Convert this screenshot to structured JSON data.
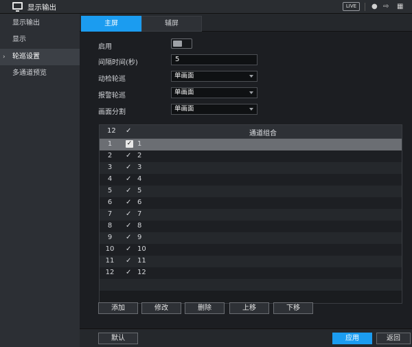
{
  "titlebar": {
    "title": "显示输出",
    "live_label": "LIVE",
    "icons": [
      "monitor-icon",
      "user-icon",
      "logout-icon",
      "grid-icon"
    ]
  },
  "sidebar": {
    "items": [
      {
        "label": "显示输出",
        "active": false
      },
      {
        "label": "显示",
        "active": false
      },
      {
        "label": "轮巡设置",
        "active": true
      },
      {
        "label": "多通道预览",
        "active": false
      }
    ]
  },
  "tabs": [
    {
      "label": "主屏",
      "active": true
    },
    {
      "label": "辅屏",
      "active": false
    }
  ],
  "form": {
    "enable_label": "启用",
    "interval_label": "间隔时间(秒)",
    "interval_value": "5",
    "motion_label": "动检轮巡",
    "motion_value": "单画面",
    "alarm_label": "报警轮巡",
    "alarm_value": "单画面",
    "split_label": "画面分割",
    "split_value": "单画面"
  },
  "table": {
    "header": {
      "count": "12",
      "check": "✓",
      "column": "通道组合"
    },
    "selected_row": 0,
    "rows": [
      {
        "num": "1",
        "check": "✓",
        "channels": "1"
      },
      {
        "num": "2",
        "check": "✓",
        "channels": "2"
      },
      {
        "num": "3",
        "check": "✓",
        "channels": "3"
      },
      {
        "num": "4",
        "check": "✓",
        "channels": "4"
      },
      {
        "num": "5",
        "check": "✓",
        "channels": "5"
      },
      {
        "num": "6",
        "check": "✓",
        "channels": "6"
      },
      {
        "num": "7",
        "check": "✓",
        "channels": "7"
      },
      {
        "num": "8",
        "check": "✓",
        "channels": "8"
      },
      {
        "num": "9",
        "check": "✓",
        "channels": "9"
      },
      {
        "num": "10",
        "check": "✓",
        "channels": "10"
      },
      {
        "num": "11",
        "check": "✓",
        "channels": "11"
      },
      {
        "num": "12",
        "check": "✓",
        "channels": "12"
      }
    ]
  },
  "actions": {
    "add": "添加",
    "modify": "修改",
    "delete": "删除",
    "move_up": "上移",
    "move_down": "下移"
  },
  "footer": {
    "default": "默认",
    "apply": "应用",
    "back": "返回"
  },
  "colors": {
    "accent": "#1b9cf0",
    "background": "#1c1e22",
    "sidebar": "#2c2f34"
  }
}
